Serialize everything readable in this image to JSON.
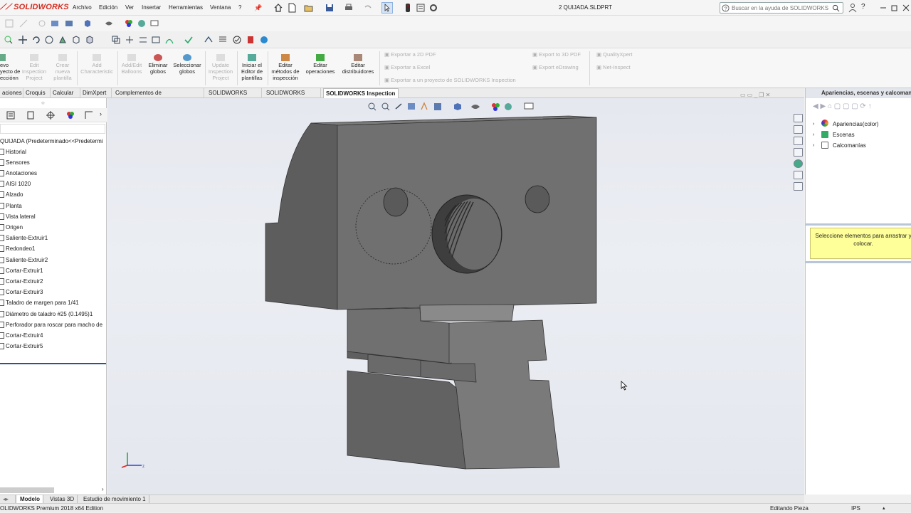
{
  "app": {
    "logo": "SOLIDWORKS",
    "document_title": "2 QUIJADA.SLDPRT",
    "search_placeholder": "Buscar en la ayuda de SOLIDWORKS"
  },
  "menu": [
    "Archivo",
    "Edición",
    "Ver",
    "Insertar",
    "Herramientas",
    "Ventana",
    "?"
  ],
  "ribbon": {
    "buttons": [
      {
        "label": "evo\nyecto de\necciónn",
        "disabled": false
      },
      {
        "label": "Edit\nInspection\nProject",
        "disabled": true
      },
      {
        "label": "Crear\nnueva\nplantilla",
        "disabled": true
      },
      {
        "label": "Add\nCharacteristic",
        "disabled": true
      },
      {
        "label": "Add/Edit\nBalloons",
        "disabled": true
      },
      {
        "label": "Eliminar\nglobos",
        "disabled": false
      },
      {
        "label": "Seleccionar\nglobos",
        "disabled": false
      },
      {
        "label": "Update\nInspection\nProject",
        "disabled": true
      },
      {
        "label": "Iniciar el\nEditor de\nplantillas",
        "disabled": false
      },
      {
        "label": "Editar\nmétodos de\ninspección",
        "disabled": false
      },
      {
        "label": "Editar\noperaciones",
        "disabled": false
      },
      {
        "label": "Editar\ndistribuidores",
        "disabled": false
      }
    ],
    "links": [
      "Exportar a 2D PDF",
      "Exportar a Excel",
      "Exportar a un proyecto de SOLIDWORKS Inspection",
      "Export to 3D PDF",
      "Export eDrawing",
      "QualityXpert",
      "Net-Inspect"
    ]
  },
  "tabs": [
    "aciones",
    "Croquis",
    "Calcular",
    "DimXpert",
    "Complementos de SOLIDWORKS",
    "SOLIDWORKS MBD",
    "SOLIDWORKS CAM",
    "SOLIDWORKS Inspection"
  ],
  "active_tab": "SOLIDWORKS Inspection",
  "feature_tree": {
    "root": "QUIJADA  (Predeterminado<<Predetermi",
    "items": [
      "Historial",
      "Sensores",
      "Anotaciones",
      "AISI 1020",
      "Alzado",
      "Planta",
      "Vista lateral",
      "Origen",
      "Saliente-Extruir1",
      "Redondeo1",
      "Saliente-Extruir2",
      "Cortar-Extruir1",
      "Cortar-Extruir2",
      "Cortar-Extruir3",
      "Taladro de margen para 1/41",
      "Diámetro de taladro #25 (0.1495)1",
      "Perforador para roscar para macho de",
      "Cortar-Extruir4",
      "Cortar-Extruir5"
    ]
  },
  "right_panel": {
    "title": "Apariencias, escenas y calcomaní",
    "items": [
      "Apariencias(color)",
      "Escenas",
      "Calcomanías"
    ],
    "hint": "Seleccione elementos para arrastrar y\ncolocar."
  },
  "bottom_tabs": [
    "Modelo",
    "Vistas 3D",
    "Estudio de movimiento 1"
  ],
  "active_bottom_tab": "Modelo",
  "status": {
    "left": "OLIDWORKS Premium 2018 x64 Edition",
    "mode": "Editando Pieza",
    "units": "IPS"
  },
  "colors": {
    "part_face_front": "#727272",
    "part_face_side": "#5c5c5c",
    "part_face_top": "#8a8a8a",
    "logo_red": "#d52b1e",
    "hint_bg": "#ffff99"
  }
}
